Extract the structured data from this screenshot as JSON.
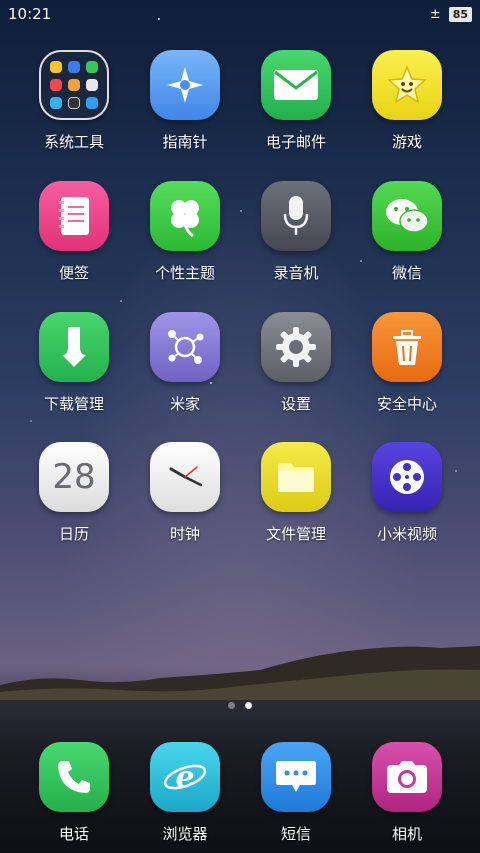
{
  "status_bar": {
    "time": "10:21",
    "data_indicator": "±",
    "battery": "85"
  },
  "apps": [
    {
      "label": "系统工具",
      "icon": "folder-icon"
    },
    {
      "label": "指南针",
      "icon": "compass-icon"
    },
    {
      "label": "电子邮件",
      "icon": "mail-icon"
    },
    {
      "label": "游戏",
      "icon": "game-icon"
    },
    {
      "label": "便签",
      "icon": "notes-icon"
    },
    {
      "label": "个性主题",
      "icon": "theme-icon"
    },
    {
      "label": "录音机",
      "icon": "microphone-icon"
    },
    {
      "label": "微信",
      "icon": "wechat-icon"
    },
    {
      "label": "下载管理",
      "icon": "download-icon"
    },
    {
      "label": "米家",
      "icon": "mijia-icon"
    },
    {
      "label": "设置",
      "icon": "settings-gear-icon"
    },
    {
      "label": "安全中心",
      "icon": "security-trash-icon"
    },
    {
      "label": "日历",
      "icon": "calendar-icon",
      "day": "28"
    },
    {
      "label": "时钟",
      "icon": "clock-icon"
    },
    {
      "label": "文件管理",
      "icon": "file-folder-icon"
    },
    {
      "label": "小米视频",
      "icon": "video-reel-icon"
    }
  ],
  "page_indicator": {
    "pages": 2,
    "active": 2
  },
  "dock": [
    {
      "label": "电话",
      "icon": "phone-icon"
    },
    {
      "label": "浏览器",
      "icon": "browser-icon"
    },
    {
      "label": "短信",
      "icon": "message-icon"
    },
    {
      "label": "相机",
      "icon": "camera-icon"
    }
  ],
  "colors": {
    "compass": "#5aa2f2",
    "mail": "#2fc25a",
    "game": "#f3e32a",
    "notes": "#f04a8c",
    "theme": "#3dcc45",
    "recorder": "#5a5e68",
    "wechat": "#3fcc3a",
    "download": "#35c25c",
    "mijia": "#8a7fd6",
    "settings": "#7a7d84",
    "security": "#f07a18",
    "calendar": "#f3f3f3",
    "clock": "#f2f2f2",
    "files": "#ecde2a",
    "video": "#4530c8",
    "phone": "#35c45a",
    "browser": "#2ac0d8",
    "sms": "#2f8ee8",
    "camera": "#c8389a"
  }
}
